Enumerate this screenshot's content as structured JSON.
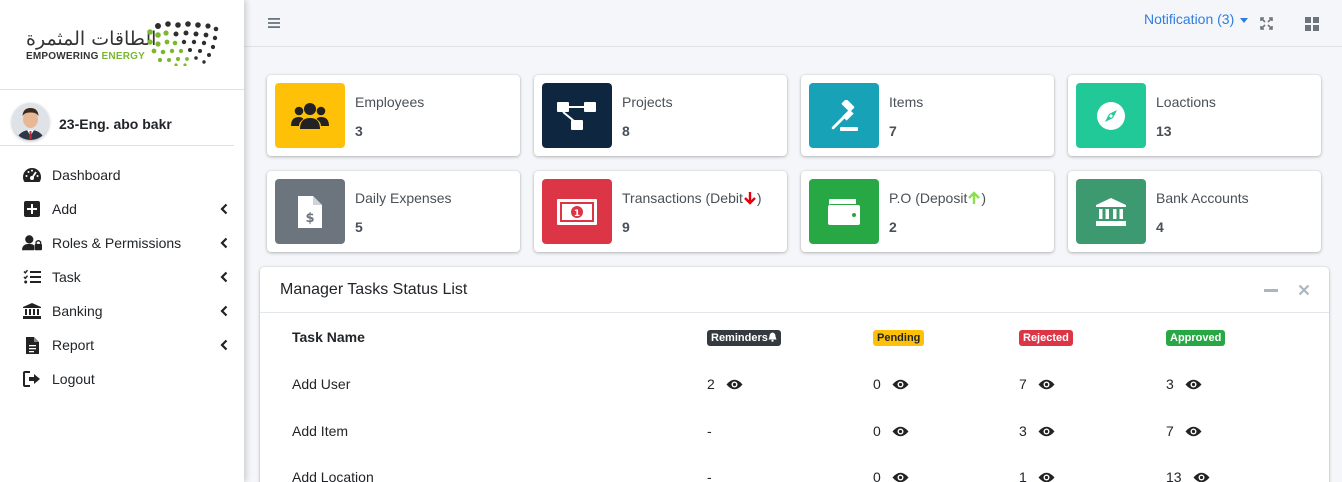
{
  "brand": {
    "arabic_name": "الطاقات المثمرة",
    "tagline_part1": "EMPOWERING",
    "tagline_part2": "ENERGY"
  },
  "user": {
    "name": "23-Eng. abo bakr"
  },
  "sidebar": {
    "items": [
      {
        "label": "Dashboard",
        "icon": "tachometer-icon",
        "has_submenu": false
      },
      {
        "label": "Add",
        "icon": "plus-square-icon",
        "has_submenu": true
      },
      {
        "label": "Roles & Permissions",
        "icon": "user-lock-icon",
        "has_submenu": true
      },
      {
        "label": "Task",
        "icon": "tasks-list-icon",
        "has_submenu": true
      },
      {
        "label": "Banking",
        "icon": "bank-icon",
        "has_submenu": true
      },
      {
        "label": "Report",
        "icon": "file-report-icon",
        "has_submenu": true
      },
      {
        "label": "Logout",
        "icon": "sign-out-icon",
        "has_submenu": false
      }
    ]
  },
  "topbar": {
    "notification_label": "Notification (3)"
  },
  "stats": [
    {
      "label": "Employees",
      "value": "3",
      "color": "#ffc107",
      "icon": "users-icon"
    },
    {
      "label": "Projects",
      "value": "8",
      "color": "#0f2640",
      "icon": "project-diagram-icon"
    },
    {
      "label": "Items",
      "value": "7",
      "color": "#17a2b8",
      "icon": "gavel-icon"
    },
    {
      "label": "Loactions",
      "value": "13",
      "color": "#20c997",
      "icon": "compass-icon"
    },
    {
      "label": "Daily Expenses",
      "value": "5",
      "color": "#6c757d",
      "icon": "file-invoice-dollar-icon"
    },
    {
      "label": "Transactions (Debit",
      "value": "9",
      "color": "#dc3545",
      "icon": "money-bill-icon",
      "arrow": "down",
      "arrow_color": "#e3000f"
    },
    {
      "label": "P.O (Deposit",
      "value": "2",
      "color": "#28a745",
      "icon": "wallet-icon",
      "arrow": "up",
      "arrow_color": "#8be04e"
    },
    {
      "label": "Bank Accounts",
      "value": "4",
      "color": "#3d9970",
      "icon": "bank-icon"
    }
  ],
  "tasks_card": {
    "title": "Manager Tasks Status List",
    "columns": {
      "name": "Task Name",
      "reminders": "Reminders",
      "pending": "Pending",
      "rejected": "Rejected",
      "approved": "Approved"
    },
    "rows": [
      {
        "name": "Add User",
        "reminders": "2",
        "pending": "0",
        "rejected": "7",
        "approved": "3"
      },
      {
        "name": "Add Item",
        "reminders": "-",
        "pending": "0",
        "rejected": "3",
        "approved": "7"
      },
      {
        "name": "Add Location",
        "reminders": "-",
        "pending": "0",
        "rejected": "1",
        "approved": "13"
      }
    ]
  }
}
